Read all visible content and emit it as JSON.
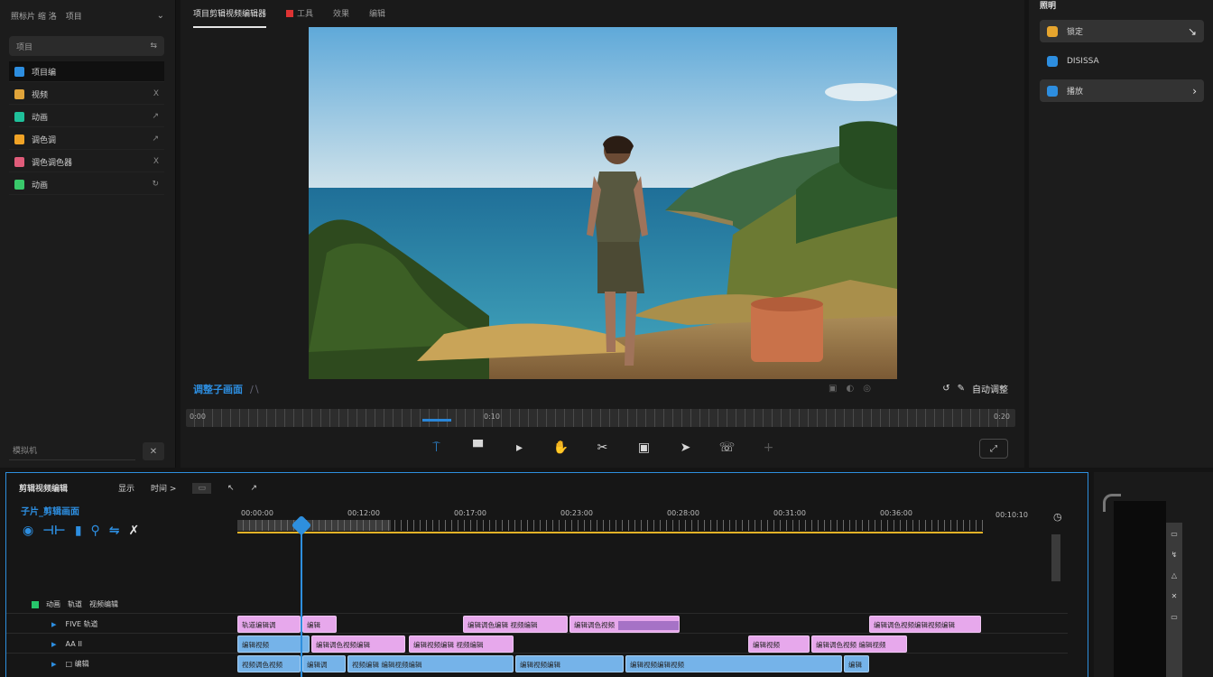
{
  "left_panel": {
    "header_tabs": [
      "照标片 缩 洛",
      "项目"
    ],
    "search_label": "项目",
    "items": [
      {
        "label": "项目编",
        "color": "#2d8ee0",
        "tail": "",
        "active": true
      },
      {
        "label": "视频",
        "color": "#e0a43a",
        "tail": "X",
        "active": false
      },
      {
        "label": "动画",
        "color": "#1fc09a",
        "tail": "↗",
        "active": false
      },
      {
        "label": "调色调",
        "color": "#f0a326",
        "tail": "↗",
        "active": false
      },
      {
        "label": "调色调色器",
        "color": "#e05c7a",
        "tail": "X",
        "active": false
      },
      {
        "label": "动画",
        "color": "#39c86a",
        "tail": "↻",
        "active": false
      }
    ],
    "footer_label": "模拟机",
    "footer_button": "✕"
  },
  "viewer": {
    "tabs": [
      "项目剪辑视频编辑器",
      "工具",
      "效果",
      "编辑"
    ],
    "timecode_left": "调整子画面",
    "controls_right": "自动调整",
    "scrub_labels": [
      "0:00",
      "0:10",
      "0:20"
    ]
  },
  "toolbar": {
    "tools": [
      {
        "name": "select-tool",
        "glyph": "⍑",
        "style": "blue"
      },
      {
        "name": "trim-tool",
        "glyph": "▀",
        "style": ""
      },
      {
        "name": "pointer-tool",
        "glyph": "▸",
        "style": ""
      },
      {
        "name": "hand-tool",
        "glyph": "✋",
        "style": ""
      },
      {
        "name": "razor-tool",
        "glyph": "✂",
        "style": ""
      },
      {
        "name": "crop-tool",
        "glyph": "▣",
        "style": ""
      },
      {
        "name": "send-tool",
        "glyph": "➤",
        "style": ""
      },
      {
        "name": "audio-tool",
        "glyph": "☏",
        "style": ""
      },
      {
        "name": "add-tool",
        "glyph": "+",
        "style": "dim"
      }
    ]
  },
  "right_panel": {
    "title": "照明",
    "items": [
      {
        "label": "锁定",
        "icon_color": "#e6a52e",
        "filled": true,
        "arrow": "↘"
      },
      {
        "label": "DISISSA",
        "icon_color": "#2d8ee0",
        "filled": false,
        "arrow": ""
      },
      {
        "label": "播放",
        "icon_color": "#2d8ee0",
        "filled": true,
        "arrow": "›"
      }
    ]
  },
  "timeline": {
    "title": "剪辑视频编辑",
    "header_items": [
      "显示",
      "时间 >",
      "",
      "↖",
      "↗"
    ],
    "project": "子片_剪辑画面",
    "track_header": [
      "动画",
      "轨道",
      "视频编辑"
    ],
    "ruler_timecodes": [
      "00:00:00",
      "00:12:00",
      "00:17:00",
      "00:23:00",
      "00:28:00",
      "00:31:00",
      "00:36:00"
    ],
    "ruler_end": "00:10:10",
    "tracks": [
      {
        "label": "FIVE   轨道",
        "clips": [
          {
            "text": "轨道编辑调",
            "color": "pink",
            "start": 0,
            "len": 70
          },
          {
            "text": "编辑",
            "color": "pink",
            "start": 72,
            "len": 38
          },
          {
            "text": "编辑调色编辑 视频编辑",
            "color": "pink",
            "start": 250,
            "len": 116
          },
          {
            "text": "编辑调色视频",
            "color": "pink",
            "start": 368,
            "len": 122,
            "bar": true
          },
          {
            "text": "编辑调色视频编辑视频编辑",
            "color": "pink",
            "start": 700,
            "len": 124
          }
        ]
      },
      {
        "label": "AA   II",
        "clips": [
          {
            "text": "编辑视频",
            "color": "blue",
            "start": 0,
            "len": 80
          },
          {
            "text": "编辑调色视频编辑",
            "color": "pink",
            "start": 82,
            "len": 104
          },
          {
            "text": "编辑视频编辑 视频编辑",
            "color": "pink",
            "start": 190,
            "len": 116
          },
          {
            "text": "编辑视频",
            "color": "pink",
            "start": 566,
            "len": 68
          },
          {
            "text": "编辑调色视频 编辑视频",
            "color": "pink",
            "start": 636,
            "len": 106
          }
        ]
      },
      {
        "label": "□    编辑",
        "clips": [
          {
            "text": "视频调色视频",
            "color": "blue",
            "start": 0,
            "len": 70
          },
          {
            "text": "编辑调",
            "color": "blue",
            "start": 72,
            "len": 48
          },
          {
            "text": "视频编辑 编辑视频编辑",
            "color": "blue",
            "start": 122,
            "len": 184
          },
          {
            "text": "编辑视频编辑",
            "color": "blue",
            "start": 308,
            "len": 120
          },
          {
            "text": "编辑视频编辑视频",
            "color": "blue",
            "start": 430,
            "len": 240
          },
          {
            "text": "编辑",
            "color": "blue",
            "start": 672,
            "len": 28
          }
        ]
      }
    ]
  },
  "mini_panel": {
    "strip_icons": [
      "▭",
      "↯",
      "△",
      "✕",
      "▭"
    ]
  },
  "colors": {
    "accent": "#2e8fde",
    "gold": "#e3b227",
    "clip_pink": "#e7a8ec",
    "clip_blue": "#75b3e9",
    "clip_green": "#1fc09a"
  }
}
